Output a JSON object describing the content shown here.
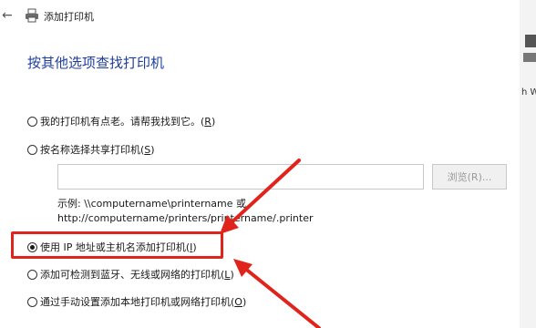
{
  "window": {
    "back_glyph": "←",
    "title": "添加打印机"
  },
  "page": {
    "heading": "按其他选项查找打印机"
  },
  "options": [
    {
      "label": "我的打印机有点老。请帮我找到它。(",
      "mnemonic": "R",
      "suffix": ")",
      "checked": false
    },
    {
      "label": "按名称选择共享打印机(",
      "mnemonic": "S",
      "suffix": ")",
      "checked": false
    },
    {
      "label": "使用 IP 地址或主机名添加打印机(",
      "mnemonic": "I",
      "suffix": ")",
      "checked": true
    },
    {
      "label": "添加可检测到蓝牙、无线或网络的打印机(",
      "mnemonic": "L",
      "suffix": ")",
      "checked": false
    },
    {
      "label": "通过手动设置添加本地打印机或网络打印机(",
      "mnemonic": "O",
      "suffix": ")",
      "checked": false
    }
  ],
  "share": {
    "input_value": "",
    "browse_label": "浏览(R)...",
    "example_line1": "示例: \\\\computername\\printername 或",
    "example_line2": "http://computername/printers/printername/.printer"
  },
  "right_edge": {
    "text": "h W"
  },
  "colors": {
    "heading": "#1f3e9c",
    "annotation": "#e0231b"
  },
  "icons": [
    "back-arrow-icon",
    "printer-icon"
  ]
}
